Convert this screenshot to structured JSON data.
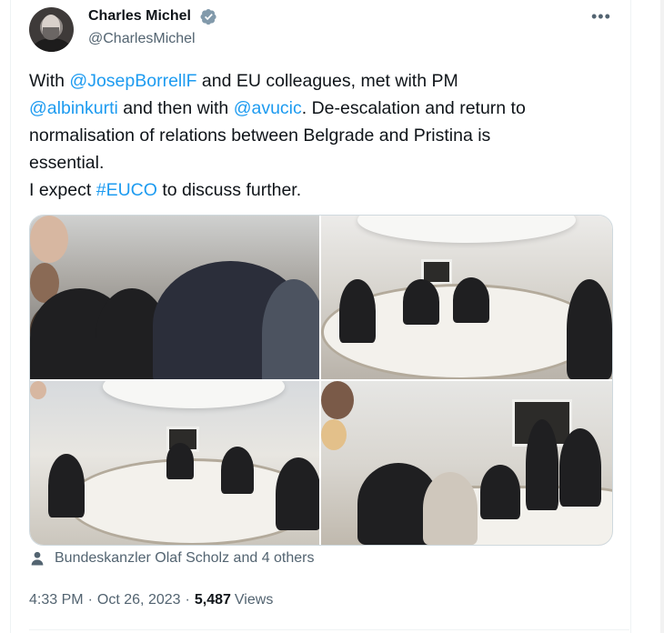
{
  "author": {
    "name": "Charles Michel",
    "handle": "@CharlesMichel",
    "verified": true
  },
  "tweet": {
    "lines": [
      [
        {
          "t": "text",
          "v": "With "
        },
        {
          "t": "mention",
          "v": "@JosepBorrellF"
        },
        {
          "t": "text",
          "v": " and EU colleagues, met with PM"
        }
      ],
      [
        {
          "t": "mention",
          "v": "@albinkurti"
        },
        {
          "t": "text",
          "v": " and then with "
        },
        {
          "t": "mention",
          "v": "@avucic"
        },
        {
          "t": "text",
          "v": ". De-escalation and return to"
        }
      ],
      [
        {
          "t": "text",
          "v": "normalisation of relations between Belgrade and Pristina is"
        }
      ],
      [
        {
          "t": "text",
          "v": "essential."
        }
      ],
      [
        {
          "t": "text",
          "v": "I expect "
        },
        {
          "t": "hashtag",
          "v": "#EUCO"
        },
        {
          "t": "text",
          "v": " to discuss further."
        }
      ]
    ]
  },
  "media": {
    "photo_count": 4
  },
  "tagged": {
    "text": "Bundeskanzler Olaf Scholz and 4 others"
  },
  "meta": {
    "time": "4:33 PM",
    "separator": "·",
    "date": "Oct 26, 2023",
    "views_count": "5,487",
    "views_label": "Views"
  },
  "icons": {
    "verified": "verified-badge-icon",
    "more": "more-dots-icon",
    "tagged": "person-icon"
  },
  "colors": {
    "link": "#1d9bf0",
    "secondary": "#536471",
    "primary": "#0f1419",
    "border": "#cfd9de"
  },
  "more_glyph": "•••"
}
